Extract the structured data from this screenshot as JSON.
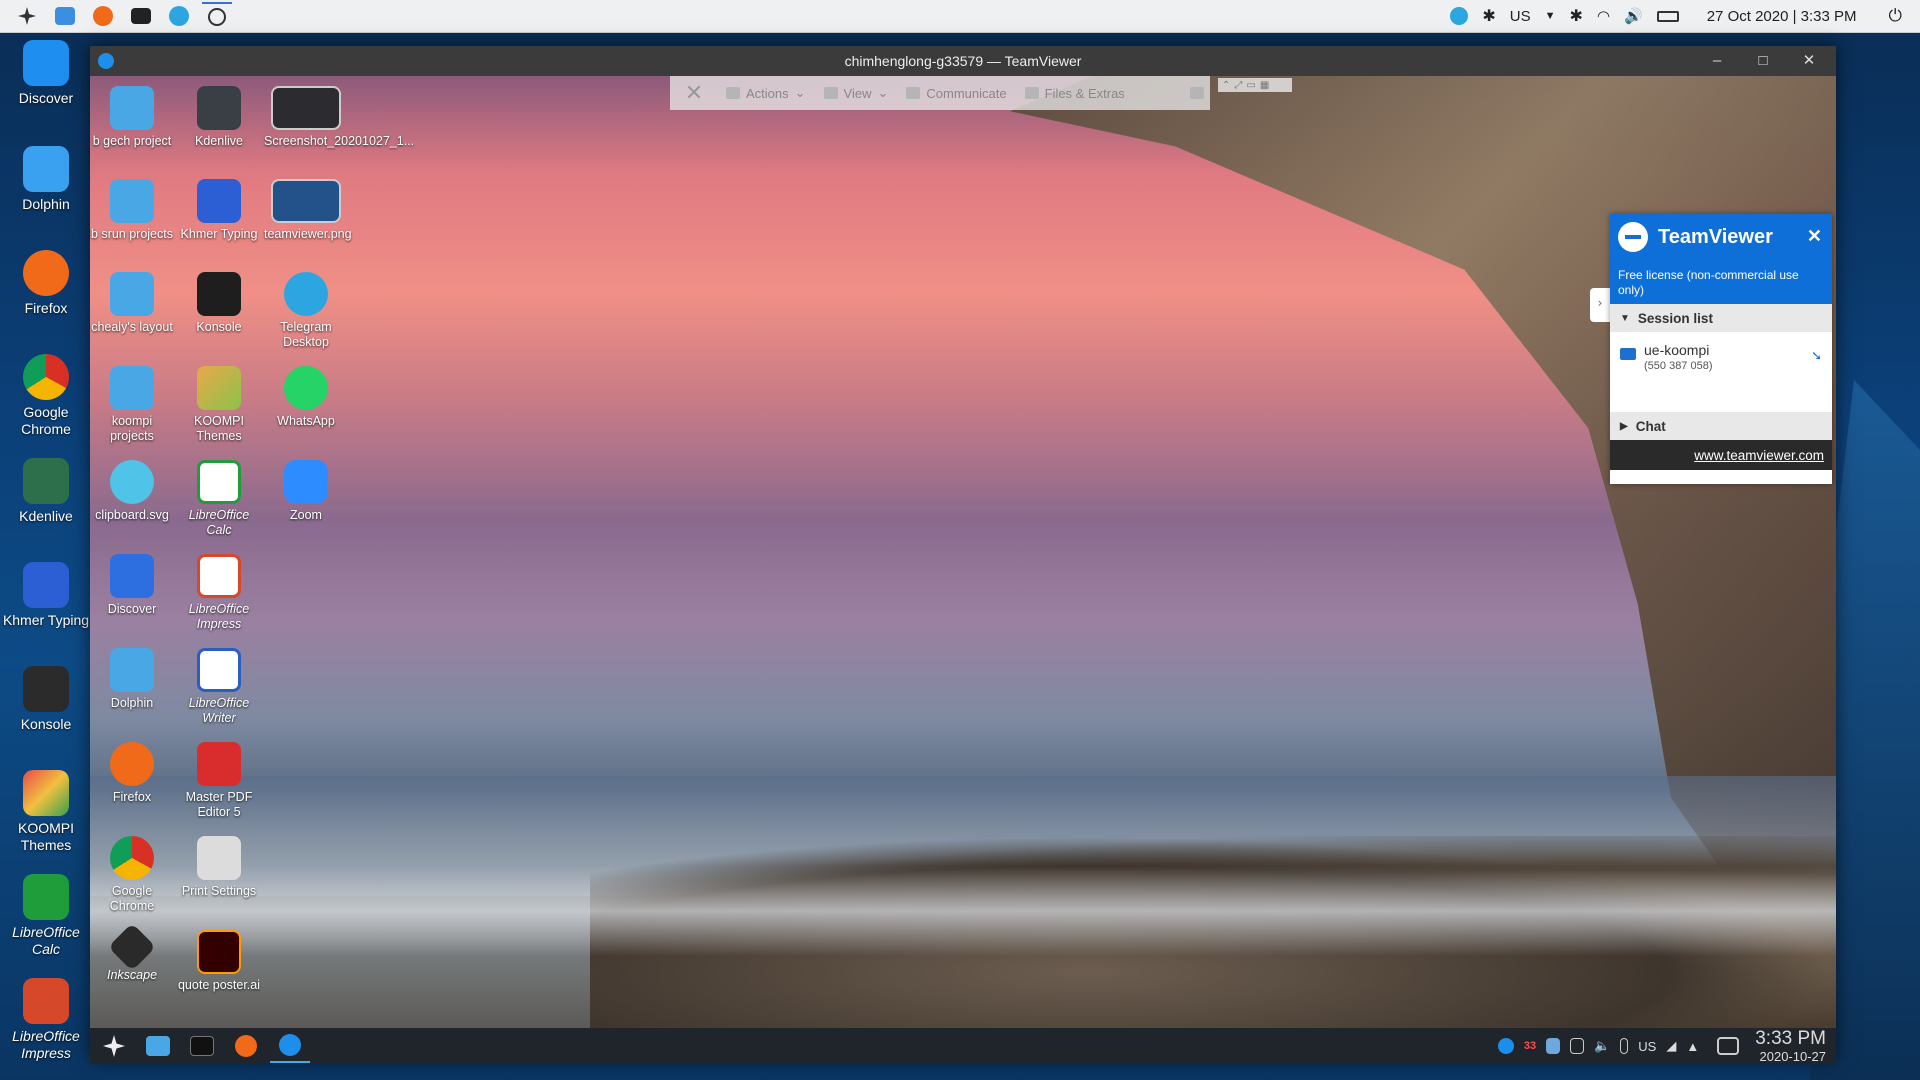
{
  "top_panel": {
    "keyboard_layout": "US",
    "datetime": "27 Oct 2020 | 3:33 PM"
  },
  "outer_dock": {
    "items": [
      {
        "label": "Discover",
        "icon": "discover-icon",
        "color": "#1e8ff0"
      },
      {
        "label": "Dolphin",
        "icon": "dolphin-icon",
        "color": "#3aa0f0"
      },
      {
        "label": "Firefox",
        "icon": "firefox-icon",
        "color": "#f06a1a"
      },
      {
        "label": "Google Chrome",
        "icon": "chrome-icon",
        "color": "#d93025"
      },
      {
        "label": "Kdenlive",
        "icon": "kdenlive-icon",
        "color": "#2c6f4a"
      },
      {
        "label": "Khmer Typing",
        "icon": "khmer-typing-icon",
        "color": "#2d5fd4"
      },
      {
        "label": "Konsole",
        "icon": "konsole-icon",
        "color": "#2b2b2b"
      },
      {
        "label": "KOOMPI Themes",
        "icon": "koompi-themes-icon",
        "color": "#e94a4a"
      },
      {
        "label": "LibreOffice Calc",
        "icon": "libreoffice-calc-icon",
        "color": "#1f9d3a"
      },
      {
        "label": "LibreOffice Impress",
        "icon": "libreoffice-impress-icon",
        "color": "#d5482a"
      }
    ]
  },
  "tv_window": {
    "title": "chimhenglong-g33579 — TeamViewer"
  },
  "remote_toolbar": {
    "actions": "Actions",
    "view": "View",
    "communicate": "Communicate",
    "files_extras": "Files & Extras"
  },
  "remote_icons": [
    {
      "label": "b gech project",
      "icon": "folder-icon",
      "color": "#4aa7e6"
    },
    {
      "label": "Kdenlive",
      "icon": "kdenlive-icon",
      "color": "#3a3f46"
    },
    {
      "label": "Screenshot_20201027_1...",
      "icon": "screenshot-thumbnail-icon",
      "color": "#2b2b30"
    },
    {
      "label": "b srun projects",
      "icon": "folder-icon",
      "color": "#4aa7e6"
    },
    {
      "label": "Khmer Typing",
      "icon": "khmer-typing-icon",
      "color": "#2d5fd4"
    },
    {
      "label": "teamviewer.png",
      "icon": "image-thumbnail-icon",
      "color": "#23518a"
    },
    {
      "label": "chealy's layout",
      "icon": "folder-icon",
      "color": "#4aa7e6"
    },
    {
      "label": "Konsole",
      "icon": "konsole-icon",
      "color": "#1e1e1e"
    },
    {
      "label": "Telegram Desktop",
      "icon": "telegram-icon",
      "color": "#2ca5e0"
    },
    {
      "label": "koompi projects",
      "icon": "folder-icon",
      "color": "#4aa7e6"
    },
    {
      "label": "KOOMPI Themes",
      "icon": "koompi-themes-icon",
      "color": "#e9a84a"
    },
    {
      "label": "WhatsApp",
      "icon": "whatsapp-icon",
      "color": "#25d366"
    },
    {
      "label": "clipboard.svg",
      "icon": "svg-file-icon",
      "color": "#4fc3e8"
    },
    {
      "label": "LibreOffice Calc",
      "icon": "libreoffice-calc-icon",
      "color": "#1f9d3a"
    },
    {
      "label": "Zoom",
      "icon": "zoom-icon",
      "color": "#2d8cff"
    },
    {
      "label": "Discover",
      "icon": "discover-icon",
      "color": "#2d6fe0"
    },
    {
      "label": "LibreOffice Impress",
      "icon": "libreoffice-impress-icon",
      "color": "#d5482a"
    },
    {
      "label": "Dolphin",
      "icon": "dolphin-folder-icon",
      "color": "#4aa7e6"
    },
    {
      "label": "LibreOffice Writer",
      "icon": "libreoffice-writer-icon",
      "color": "#2a5fbf"
    },
    {
      "label": "Firefox",
      "icon": "firefox-icon",
      "color": "#f06a1a"
    },
    {
      "label": "Master PDF Editor 5",
      "icon": "master-pdf-icon",
      "color": "#d92d2d"
    },
    {
      "label": "Google Chrome",
      "icon": "chrome-icon",
      "color": "#d93025"
    },
    {
      "label": "Print Settings",
      "icon": "printer-icon",
      "color": "#dcdcdc"
    },
    {
      "label": "Inkscape",
      "icon": "inkscape-icon",
      "color": "#2a2a2a"
    },
    {
      "label": "quote poster.ai",
      "icon": "illustrator-icon",
      "color": "#330000"
    }
  ],
  "tv_panel": {
    "brand": "TeamViewer",
    "license": "Free license (non-commercial use only)",
    "session_list_label": "Session list",
    "session_name": "ue-koompi",
    "session_id": "(550 387 058)",
    "chat_label": "Chat",
    "footer_link": "www.teamviewer.com"
  },
  "remote_taskbar": {
    "badge_count": "33",
    "keyboard_layout": "US",
    "time": "3:33 PM",
    "date": "2020-10-27"
  }
}
